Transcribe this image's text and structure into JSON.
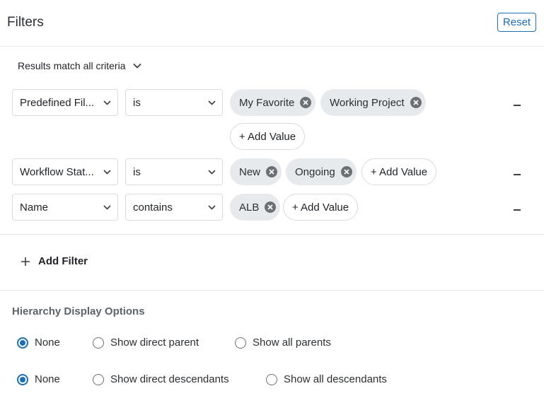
{
  "header": {
    "title": "Filters",
    "reset_label": "Reset"
  },
  "match": {
    "label": "Results match all criteria"
  },
  "rows": [
    {
      "field": "Predefined Fil...",
      "operator": "is",
      "values": [
        "My Favorite",
        "Working Project"
      ],
      "add_label": "+ Add Value"
    },
    {
      "field": "Workflow Stat...",
      "operator": "is",
      "values": [
        "New",
        "Ongoing"
      ],
      "add_label": "+ Add Value"
    },
    {
      "field": "Name",
      "operator": "contains",
      "values": [
        "ALB"
      ],
      "add_label": "+ Add Value"
    }
  ],
  "add_filter": {
    "label": "Add Filter"
  },
  "hierarchy": {
    "title": "Hierarchy Display Options",
    "parents": {
      "options": [
        "None",
        "Show direct parent",
        "Show all parents"
      ],
      "selected": "None"
    },
    "descendants": {
      "options": [
        "None",
        "Show direct descendants",
        "Show all descendants"
      ],
      "selected": "None"
    }
  },
  "colors": {
    "accent": "#1b6fb5",
    "chip_bg": "#e7eaed",
    "border": "#d8dbdf"
  },
  "icons": {
    "chevron": "chevron-down-icon",
    "chip_remove": "close-circle-icon",
    "row_remove": "minus-icon",
    "add": "plus-icon"
  }
}
